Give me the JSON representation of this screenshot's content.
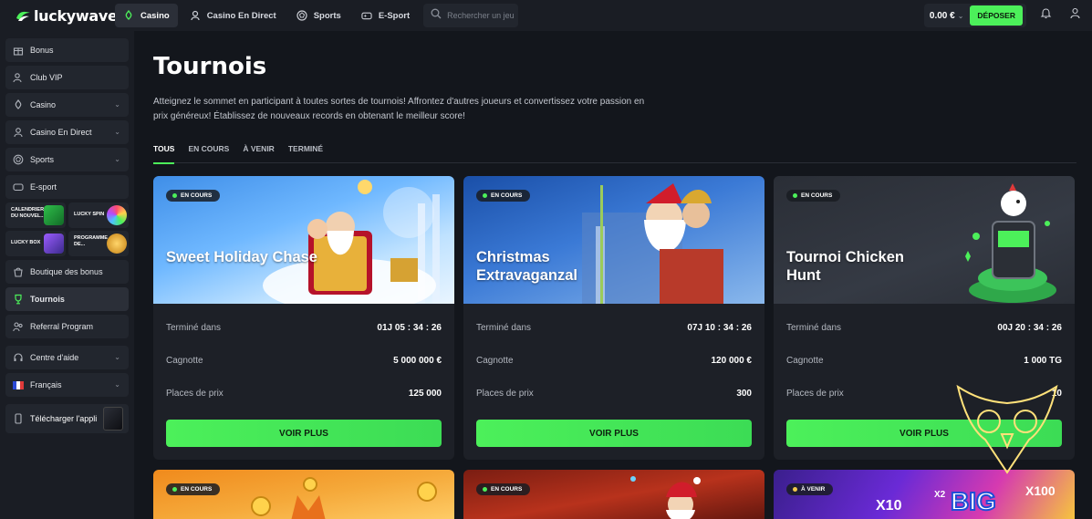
{
  "brand": {
    "name": "luckywave",
    "accent": "#4cf05a"
  },
  "topnav": {
    "items": [
      {
        "label": "Casino",
        "icon": "club-icon",
        "active": true
      },
      {
        "label": "Casino En Direct",
        "icon": "dealer-icon",
        "active": false
      },
      {
        "label": "Sports",
        "icon": "ball-icon",
        "active": false
      },
      {
        "label": "E-Sport",
        "icon": "gamepad-icon",
        "active": false
      }
    ],
    "search_placeholder": "Rechercher un jeu",
    "balance": "0.00 €",
    "deposit_label": "DÉPOSER"
  },
  "sidebar": {
    "items": [
      {
        "label": "Bonus",
        "icon": "gift-icon"
      },
      {
        "label": "Club VIP",
        "icon": "users-icon"
      },
      {
        "label": "Casino",
        "icon": "club-icon"
      },
      {
        "label": "Casino En Direct",
        "icon": "dealer-icon"
      },
      {
        "label": "Sports",
        "icon": "ball-icon"
      },
      {
        "label": "E-sport",
        "icon": "gamepad-icon"
      }
    ],
    "promos": [
      {
        "label": "CALENDRIER DU NOUVEL..."
      },
      {
        "label": "LUCKY SPIN"
      },
      {
        "label": "LUCKY BOX"
      },
      {
        "label": "PROGRAMME DE..."
      }
    ],
    "items2": [
      {
        "label": "Boutique des bonus",
        "icon": "shop-icon"
      },
      {
        "label": "Tournois",
        "icon": "trophy-icon"
      },
      {
        "label": "Referral Program",
        "icon": "referral-icon"
      },
      {
        "label": "Centre d'aide",
        "icon": "help-icon"
      },
      {
        "label": "Français",
        "icon": "flag-fr-icon"
      }
    ],
    "app_label": "Télécharger l'appli"
  },
  "page": {
    "title": "Tournois",
    "description": "Atteignez le sommet en participant à toutes sortes de tournois! Affrontez d'autres joueurs et convertissez votre passion en prix généreux! Établissez de nouveaux records en obtenant le meilleur score!",
    "tabs": [
      "TOUS",
      "EN COURS",
      "À VENIR",
      "TERMINÉ"
    ]
  },
  "cards": [
    {
      "badge": "EN COURS",
      "title": "Sweet Holiday Chase",
      "ends_label": "Terminé dans",
      "ends_value": "01J  05 : 34 : 26",
      "pot_label": "Cagnotte",
      "pot_value": "5 000 000 €",
      "places_label": "Places de prix",
      "places_value": "125 000",
      "cta": "VOIR PLUS"
    },
    {
      "badge": "EN COURS",
      "title": "Christmas Extravaganzal",
      "ends_label": "Terminé dans",
      "ends_value": "07J  10 : 34 : 26",
      "pot_label": "Cagnotte",
      "pot_value": "120 000 €",
      "places_label": "Places de prix",
      "places_value": "300",
      "cta": "VOIR PLUS"
    },
    {
      "badge": "EN COURS",
      "title": "Tournoi Chicken Hunt",
      "ends_label": "Terminé dans",
      "ends_value": "00J  20 : 34 : 26",
      "pot_label": "Cagnotte",
      "pot_value": "1 000 TG",
      "places_label": "Places de prix",
      "places_value": "10",
      "cta": "VOIR PLUS"
    }
  ],
  "cards_row2": [
    {
      "badge": "EN COURS"
    },
    {
      "badge": "EN COURS"
    },
    {
      "badge": "À VENIR",
      "art_text": "BIG"
    }
  ]
}
